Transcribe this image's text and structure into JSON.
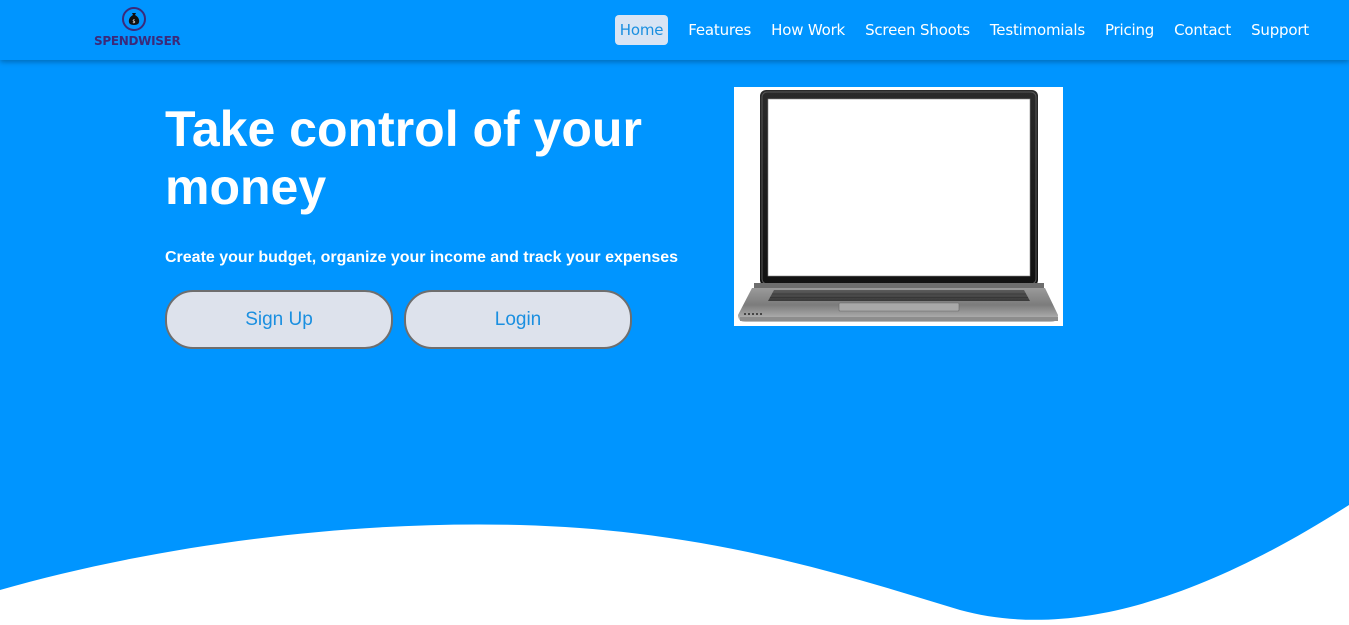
{
  "brand": {
    "name": "SPENDWISER",
    "icon": "money-bag-icon",
    "color": "#3b2a7a"
  },
  "nav": {
    "items": [
      {
        "label": "Home",
        "active": true
      },
      {
        "label": "Features"
      },
      {
        "label": "How Work"
      },
      {
        "label": "Screen Shoots"
      },
      {
        "label": "Testimomials"
      },
      {
        "label": "Pricing"
      },
      {
        "label": "Contact"
      },
      {
        "label": "Support"
      }
    ]
  },
  "hero": {
    "title": "Take control of your money",
    "subtitle": "Create your budget, organize your income and track your expenses",
    "signup_label": "Sign Up",
    "login_label": "Login",
    "image": "laptop-illustration"
  },
  "colors": {
    "background": "#0095ff",
    "button_bg": "#dde2ec",
    "button_text": "#1a8fe0",
    "active_nav_bg": "#d8e4f4",
    "wave": "#ffffff"
  }
}
